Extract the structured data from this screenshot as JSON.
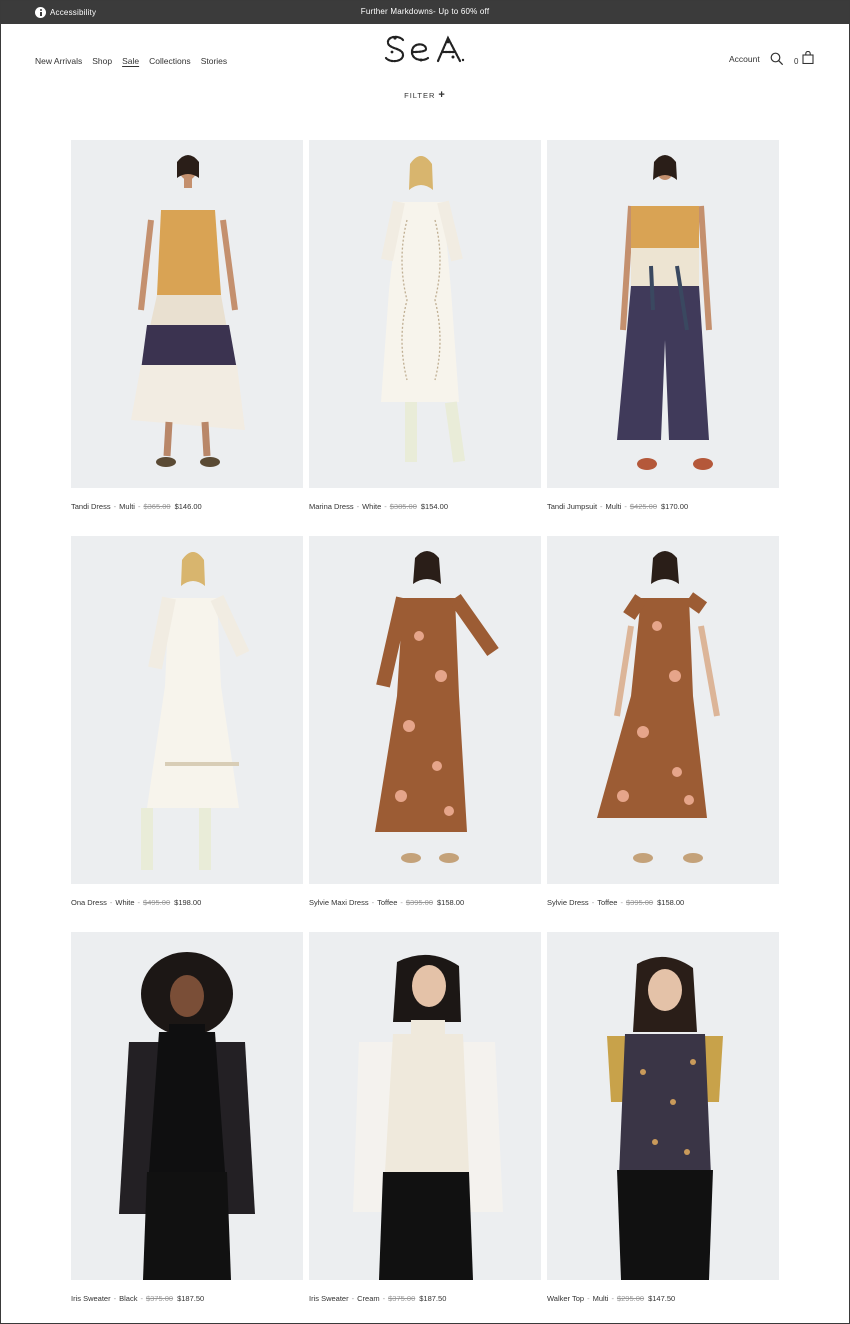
{
  "announcement": {
    "accessibility_label": "Accessibility",
    "promo_text": "Further Markdowns- Up to 60% off"
  },
  "header": {
    "nav": [
      "New Arrivals",
      "Shop",
      "Sale",
      "Collections",
      "Stories"
    ],
    "active_nav": "Sale",
    "logo_text": "SeA",
    "account_label": "Account",
    "cart_count": "0",
    "filter_label": "FILTER",
    "filter_icon": "+"
  },
  "colors": {
    "announcement_bg": "#3b3b3b",
    "photo_bg": "#eceef0",
    "strike_price": "#999999"
  },
  "products": [
    {
      "name": "Tandi Dress",
      "color": "Multi",
      "original_price": "$365.00",
      "sale_price": "$146.00"
    },
    {
      "name": "Marina Dress",
      "color": "White",
      "original_price": "$385.00",
      "sale_price": "$154.00"
    },
    {
      "name": "Tandi Jumpsuit",
      "color": "Multi",
      "original_price": "$425.00",
      "sale_price": "$170.00"
    },
    {
      "name": "Ona Dress",
      "color": "White",
      "original_price": "$495.00",
      "sale_price": "$198.00"
    },
    {
      "name": "Sylvie Maxi Dress",
      "color": "Toffee",
      "original_price": "$395.00",
      "sale_price": "$158.00"
    },
    {
      "name": "Sylvie Dress",
      "color": "Toffee",
      "original_price": "$395.00",
      "sale_price": "$158.00"
    },
    {
      "name": "Iris Sweater",
      "color": "Black",
      "original_price": "$375.00",
      "sale_price": "$187.50"
    },
    {
      "name": "Iris Sweater",
      "color": "Cream",
      "original_price": "$375.00",
      "sale_price": "$187.50"
    },
    {
      "name": "Walker Top",
      "color": "Multi",
      "original_price": "$295.00",
      "sale_price": "$147.50"
    }
  ]
}
